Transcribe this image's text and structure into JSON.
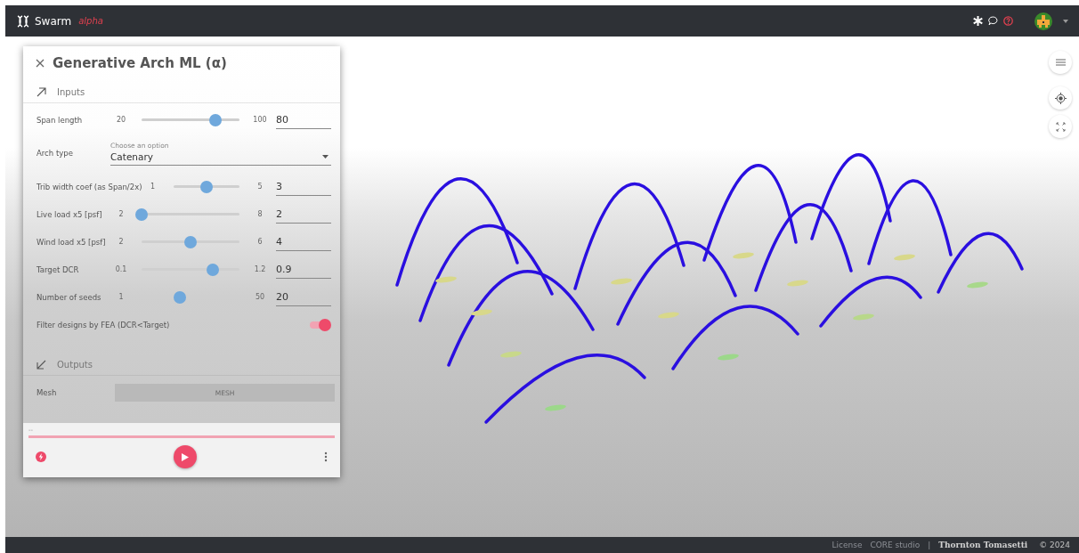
{
  "header": {
    "app_name": "Swarm",
    "badge": "alpha"
  },
  "panel": {
    "title": "Generative Arch ML (α)",
    "inputs_heading": "Inputs",
    "outputs_heading": "Outputs",
    "inputs": [
      {
        "kind": "slider",
        "label": "Span length",
        "min": "20",
        "max": "100",
        "level": 0.75,
        "value": "80"
      },
      {
        "kind": "select",
        "label": "Arch type",
        "placeholder": "Choose an option",
        "value": "Catenary"
      },
      {
        "kind": "slider",
        "label": "Trib width coef (as Span/2x)",
        "min": "1",
        "max": "5",
        "level": 0.5,
        "value": "3"
      },
      {
        "kind": "slider",
        "label": "Live load x5 [psf]",
        "min": "2",
        "max": "8",
        "level": 0,
        "value": "2"
      },
      {
        "kind": "slider",
        "label": "Wind load x5 [psf]",
        "min": "2",
        "max": "6",
        "level": 0.5,
        "value": "4"
      },
      {
        "kind": "slider",
        "label": "Target DCR",
        "min": "0.1",
        "max": "1.2",
        "level": 0.73,
        "value": "0.9"
      },
      {
        "kind": "slider",
        "label": "Number of seeds",
        "min": "1",
        "max": "50",
        "level": 0.39,
        "value": "20"
      },
      {
        "kind": "toggle",
        "label": "Filter designs by FEA (DCR<Target)",
        "on": true
      }
    ],
    "outputs": [
      {
        "label": "Mesh",
        "button": "MESH"
      }
    ],
    "status": "--"
  },
  "footer": {
    "links": [
      "License",
      "CORE studio"
    ],
    "separator": "|",
    "company": "Thornton Tomasetti",
    "copyright": "© 2024"
  }
}
